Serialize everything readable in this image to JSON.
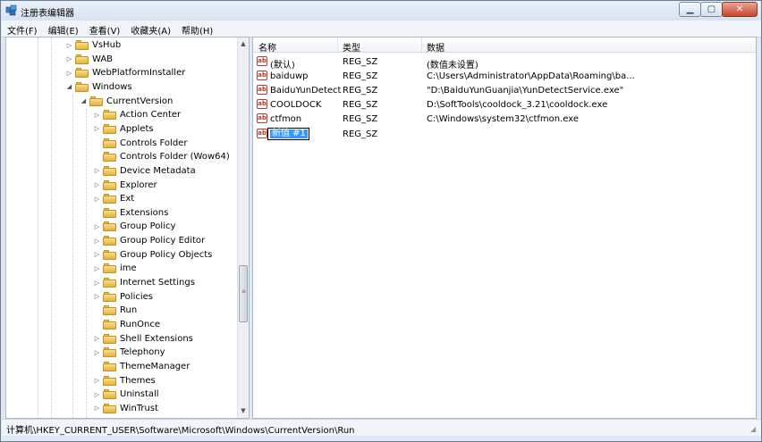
{
  "window": {
    "title": "注册表编辑器"
  },
  "menu": [
    "文件(F)",
    "编辑(E)",
    "查看(V)",
    "收藏夹(A)",
    "帮助(H)"
  ],
  "tree": [
    {
      "label": "VsHub",
      "level": 1,
      "expander": "▷"
    },
    {
      "label": "WAB",
      "level": 1,
      "expander": "▷"
    },
    {
      "label": "WebPlatformInstaller",
      "level": 1,
      "expander": "▷"
    },
    {
      "label": "Windows",
      "level": 1,
      "expander": "◢"
    },
    {
      "label": "CurrentVersion",
      "level": 2,
      "expander": "◢"
    },
    {
      "label": "Action Center",
      "level": 3,
      "expander": "▷"
    },
    {
      "label": "Applets",
      "level": 3,
      "expander": "▷"
    },
    {
      "label": "Controls Folder",
      "level": 3,
      "expander": ""
    },
    {
      "label": "Controls Folder (Wow64)",
      "level": 3,
      "expander": ""
    },
    {
      "label": "Device Metadata",
      "level": 3,
      "expander": "▷"
    },
    {
      "label": "Explorer",
      "level": 3,
      "expander": "▷"
    },
    {
      "label": "Ext",
      "level": 3,
      "expander": "▷"
    },
    {
      "label": "Extensions",
      "level": 3,
      "expander": ""
    },
    {
      "label": "Group Policy",
      "level": 3,
      "expander": "▷"
    },
    {
      "label": "Group Policy Editor",
      "level": 3,
      "expander": "▷"
    },
    {
      "label": "Group Policy Objects",
      "level": 3,
      "expander": "▷"
    },
    {
      "label": "ime",
      "level": 3,
      "expander": "▷"
    },
    {
      "label": "Internet Settings",
      "level": 3,
      "expander": "▷"
    },
    {
      "label": "Policies",
      "level": 3,
      "expander": "▷"
    },
    {
      "label": "Run",
      "level": 3,
      "expander": ""
    },
    {
      "label": "RunOnce",
      "level": 3,
      "expander": ""
    },
    {
      "label": "Shell Extensions",
      "level": 3,
      "expander": "▷"
    },
    {
      "label": "Telephony",
      "level": 3,
      "expander": "▷"
    },
    {
      "label": "ThemeManager",
      "level": 3,
      "expander": ""
    },
    {
      "label": "Themes",
      "level": 3,
      "expander": "▷"
    },
    {
      "label": "Uninstall",
      "level": 3,
      "expander": "▷"
    },
    {
      "label": "WinTrust",
      "level": 3,
      "expander": "▷"
    }
  ],
  "values": {
    "headers": [
      "名称",
      "类型",
      "数据"
    ],
    "rows": [
      {
        "name": "(默认)",
        "type": "REG_SZ",
        "data": "(数值未设置)"
      },
      {
        "name": "baiduwp",
        "type": "REG_SZ",
        "data": "C:\\Users\\Administrator\\AppData\\Roaming\\ba..."
      },
      {
        "name": "BaiduYunDetect",
        "type": "REG_SZ",
        "data": "\"D:\\BaiduYunGuanjia\\YunDetectService.exe\""
      },
      {
        "name": "COOLDOCK",
        "type": "REG_SZ",
        "data": "D:\\SoftTools\\cooldock_3.21\\cooldock.exe"
      },
      {
        "name": "ctfmon",
        "type": "REG_SZ",
        "data": "C:\\Windows\\system32\\ctfmon.exe"
      }
    ],
    "new_value": {
      "name": "新值 #1",
      "type": "REG_SZ"
    }
  },
  "status": {
    "path": "计算机\\HKEY_CURRENT_USER\\Software\\Microsoft\\Windows\\CurrentVersion\\Run"
  },
  "icons": {
    "app": "registry-editor-icon",
    "folder": "folder-icon",
    "string_value": "ab-string-icon",
    "window_buttons": [
      "minimize-icon",
      "maximize-icon",
      "close-icon"
    ]
  }
}
